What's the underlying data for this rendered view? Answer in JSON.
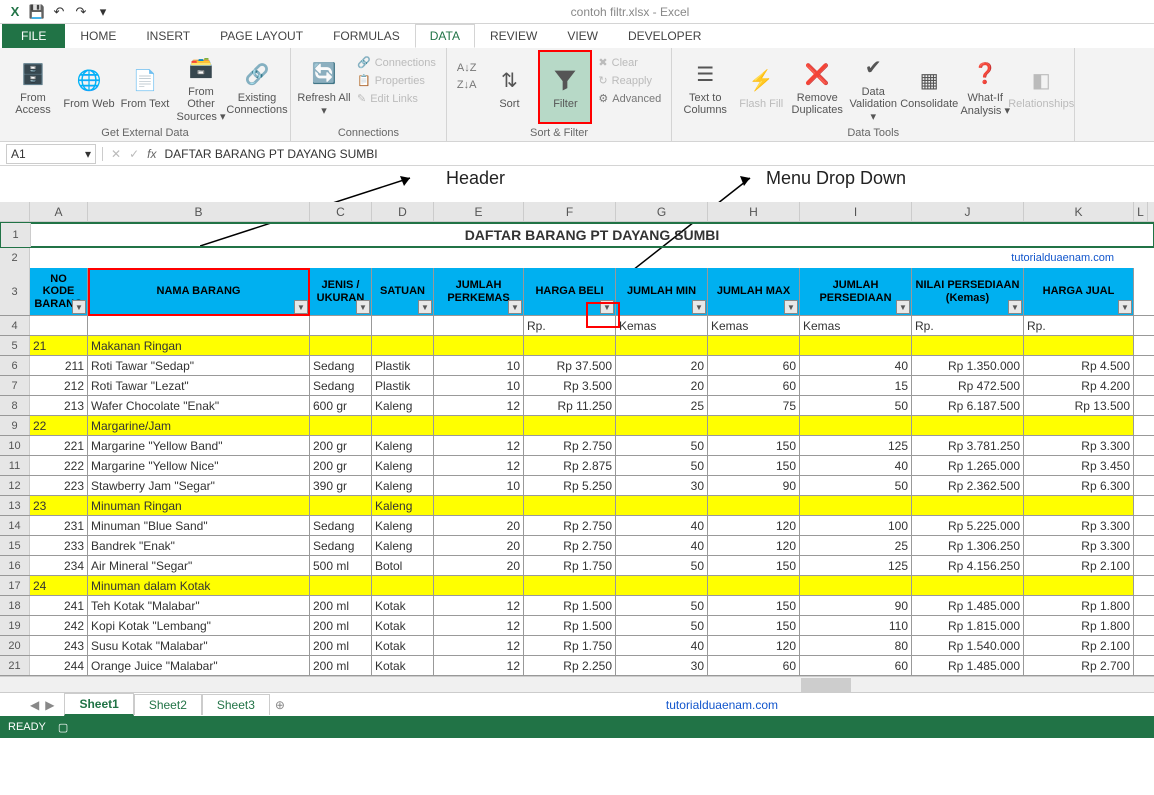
{
  "app": {
    "title": "contoh filtr.xlsx - Excel"
  },
  "qat": {
    "excel": "X",
    "save": "💾",
    "undo": "↶",
    "redo": "↷"
  },
  "tabs": {
    "file": "FILE",
    "home": "HOME",
    "insert": "INSERT",
    "pagelayout": "PAGE LAYOUT",
    "formulas": "FORMULAS",
    "data": "DATA",
    "review": "REVIEW",
    "view": "VIEW",
    "developer": "DEVELOPER"
  },
  "ribbon": {
    "getdata": {
      "label": "Get External Data",
      "access": "From Access",
      "web": "From Web",
      "text": "From Text",
      "other": "From Other Sources ▾",
      "existing": "Existing Connections"
    },
    "connections": {
      "label": "Connections",
      "refresh": "Refresh All ▾",
      "conn": "Connections",
      "prop": "Properties",
      "links": "Edit Links"
    },
    "sortfilter": {
      "label": "Sort & Filter",
      "az": "A↓Z",
      "za": "Z↓A",
      "sort": "Sort",
      "filter": "Filter",
      "clear": "Clear",
      "reapply": "Reapply",
      "advanced": "Advanced"
    },
    "datatools": {
      "label": "Data Tools",
      "t2c": "Text to Columns",
      "flash": "Flash Fill",
      "remdup": "Remove Duplicates",
      "valid": "Data Validation ▾",
      "consol": "Consolidate",
      "whatif": "What-If Analysis ▾",
      "rel": "Relationships"
    }
  },
  "namebox": "A1",
  "formula": "DAFTAR BARANG PT DAYANG SUMBI",
  "anno": {
    "header": "Header",
    "dropdown": "Menu Drop Down"
  },
  "cols": [
    "A",
    "B",
    "C",
    "D",
    "E",
    "F",
    "G",
    "H",
    "I",
    "J",
    "K",
    "L"
  ],
  "titlecell": "DAFTAR BARANG PT DAYANG SUMBI",
  "credit": "tutorialduaenam.com",
  "headers": [
    "NO KODE BARANG",
    "NAMA BARANG",
    "JENIS / UKURAN",
    "SATUAN",
    "JUMLAH PERKEMAS",
    "HARGA BELI",
    "JUMLAH MIN",
    "JUMLAH MAX",
    "JUMLAH PERSEDIAAN",
    "NILAI PERSEDIAAN (Kemas)",
    "HARGA JUAL"
  ],
  "row4": [
    "",
    "",
    "",
    "",
    "",
    "Rp.",
    "Kemas",
    "Kemas",
    "Kemas",
    "Rp.",
    "Rp."
  ],
  "rows": [
    {
      "n": 5,
      "y": true,
      "d": [
        "21",
        "Makanan Ringan",
        "",
        "",
        "",
        "",
        "",
        "",
        "",
        "",
        ""
      ]
    },
    {
      "n": 6,
      "d": [
        "211",
        "Roti Tawar \"Sedap\"",
        "Sedang",
        "Plastik",
        "10",
        "Rp     37.500",
        "20",
        "60",
        "40",
        "Rp   1.350.000",
        "Rp          4.500"
      ]
    },
    {
      "n": 7,
      "d": [
        "212",
        "Roti Tawar \"Lezat\"",
        "Sedang",
        "Plastik",
        "10",
        "Rp       3.500",
        "20",
        "60",
        "15",
        "Rp      472.500",
        "Rp          4.200"
      ]
    },
    {
      "n": 8,
      "d": [
        "213",
        "Wafer Chocolate \"Enak\"",
        "600 gr",
        "Kaleng",
        "12",
        "Rp     11.250",
        "25",
        "75",
        "50",
        "Rp   6.187.500",
        "Rp        13.500"
      ]
    },
    {
      "n": 9,
      "y": true,
      "d": [
        "22",
        "Margarine/Jam",
        "",
        "",
        "",
        "",
        "",
        "",
        "",
        "",
        ""
      ]
    },
    {
      "n": 10,
      "d": [
        "221",
        "Margarine \"Yellow Band\"",
        "200 gr",
        "Kaleng",
        "12",
        "Rp       2.750",
        "50",
        "150",
        "125",
        "Rp   3.781.250",
        "Rp          3.300"
      ]
    },
    {
      "n": 11,
      "d": [
        "222",
        "Margarine \"Yellow Nice\"",
        "200 gr",
        "Kaleng",
        "12",
        "Rp       2.875",
        "50",
        "150",
        "40",
        "Rp   1.265.000",
        "Rp          3.450"
      ]
    },
    {
      "n": 12,
      "d": [
        "223",
        "Stawberry Jam \"Segar\"",
        "390 gr",
        "Kaleng",
        "10",
        "Rp       5.250",
        "30",
        "90",
        "50",
        "Rp   2.362.500",
        "Rp          6.300"
      ]
    },
    {
      "n": 13,
      "y": true,
      "d": [
        "23",
        "Minuman Ringan",
        "",
        "Kaleng",
        "",
        "",
        "",
        "",
        "",
        "",
        ""
      ]
    },
    {
      "n": 14,
      "d": [
        "231",
        "Minuman \"Blue Sand\"",
        "Sedang",
        "Kaleng",
        "20",
        "Rp       2.750",
        "40",
        "120",
        "100",
        "Rp   5.225.000",
        "Rp          3.300"
      ]
    },
    {
      "n": 15,
      "d": [
        "233",
        "Bandrek \"Enak\"",
        "Sedang",
        "Kaleng",
        "20",
        "Rp       2.750",
        "40",
        "120",
        "25",
        "Rp   1.306.250",
        "Rp          3.300"
      ]
    },
    {
      "n": 16,
      "d": [
        "234",
        "Air Mineral \"Segar\"",
        "500 ml",
        "Botol",
        "20",
        "Rp       1.750",
        "50",
        "150",
        "125",
        "Rp   4.156.250",
        "Rp          2.100"
      ]
    },
    {
      "n": 17,
      "y": true,
      "d": [
        "24",
        "Minuman dalam Kotak",
        "",
        "",
        "",
        "",
        "",
        "",
        "",
        "",
        ""
      ]
    },
    {
      "n": 18,
      "d": [
        "241",
        "Teh Kotak \"Malabar\"",
        "200 ml",
        "Kotak",
        "12",
        "Rp       1.500",
        "50",
        "150",
        "90",
        "Rp   1.485.000",
        "Rp          1.800"
      ]
    },
    {
      "n": 19,
      "d": [
        "242",
        "Kopi Kotak \"Lembang\"",
        "200 ml",
        "Kotak",
        "12",
        "Rp       1.500",
        "50",
        "150",
        "110",
        "Rp   1.815.000",
        "Rp          1.800"
      ]
    },
    {
      "n": 20,
      "d": [
        "243",
        "Susu Kotak \"Malabar\"",
        "200 ml",
        "Kotak",
        "12",
        "Rp       1.750",
        "40",
        "120",
        "80",
        "Rp   1.540.000",
        "Rp          2.100"
      ]
    },
    {
      "n": 21,
      "d": [
        "244",
        "Orange Juice \"Malabar\"",
        "200 ml",
        "Kotak",
        "12",
        "Rp       2.250",
        "30",
        "60",
        "60",
        "Rp   1.485.000",
        "Rp          2.700"
      ]
    }
  ],
  "sheets": {
    "s1": "Sheet1",
    "s2": "Sheet2",
    "s3": "Sheet3"
  },
  "status": {
    "ready": "READY"
  }
}
